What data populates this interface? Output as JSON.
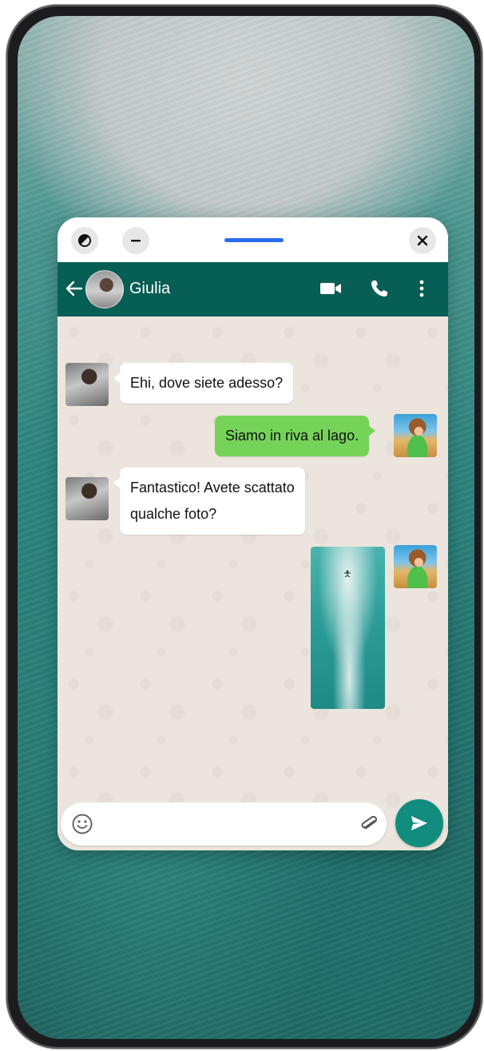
{
  "window": {
    "controls": {
      "compact_icon": "half-circle-icon",
      "minimize_icon": "minus-icon",
      "close_icon": "close-icon"
    }
  },
  "header": {
    "contact_name": "Giulia",
    "icons": [
      "back-arrow-icon",
      "video-call-icon",
      "phone-icon",
      "more-vertical-icon"
    ],
    "color": "#075e54"
  },
  "messages": [
    {
      "direction": "in",
      "text": "Ehi, dove siete adesso?"
    },
    {
      "direction": "out",
      "text": "Siamo in riva al lago."
    },
    {
      "direction": "in",
      "lines": [
        "Fantastico! Avete scattato",
        "qualche foto?"
      ]
    },
    {
      "direction": "out",
      "type": "photo"
    }
  ],
  "composer": {
    "value": "",
    "emoji_icon": "emoji-icon",
    "attach_icon": "paperclip-icon",
    "send_icon": "send-icon",
    "send_color": "#128c7e"
  },
  "colors": {
    "outgoing_bubble": "#76d35a",
    "incoming_bubble": "#ffffff",
    "chat_background": "#ece5dd",
    "drag_handle": "#2a6cf0"
  }
}
